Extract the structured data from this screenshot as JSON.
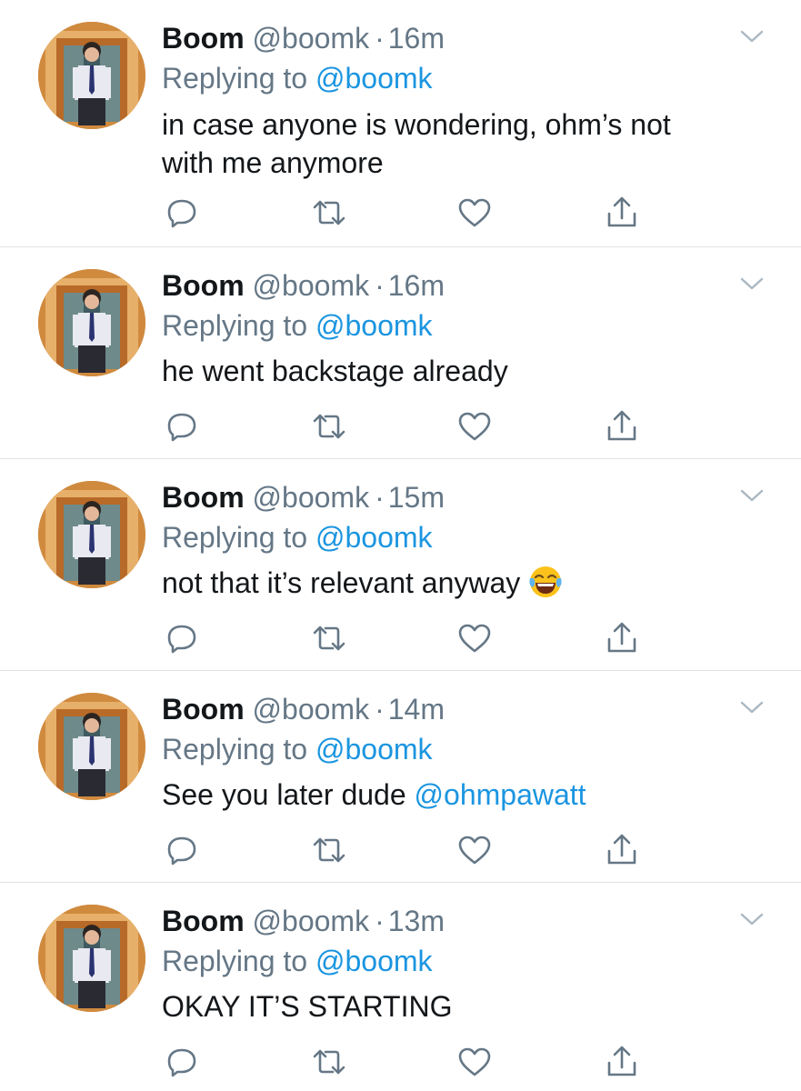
{
  "theme": {
    "text_color": "#14171a",
    "secondary_color": "#657786",
    "link_color": "#1b95e0",
    "divider_color": "#dfe3e7"
  },
  "icons": {
    "caret": "chevron-down-icon",
    "reply": "reply-icon",
    "retweet": "retweet-icon",
    "like": "heart-icon",
    "share": "share-icon",
    "emoji": "face-with-tears-of-joy-emoji"
  },
  "tweets": [
    {
      "name": "Boom",
      "handle": "@boomk",
      "dot": "·",
      "time": "16m",
      "replying_prefix": "Replying to",
      "replying_to": "@boomk",
      "text": "in case anyone is wondering, ohm’s not with me anymore"
    },
    {
      "name": "Boom",
      "handle": "@boomk",
      "dot": "·",
      "time": "16m",
      "replying_prefix": "Replying to",
      "replying_to": "@boomk",
      "text": "he went backstage already"
    },
    {
      "name": "Boom",
      "handle": "@boomk",
      "dot": "·",
      "time": "15m",
      "replying_prefix": "Replying to",
      "replying_to": "@boomk",
      "text": "not that it’s relevant anyway"
    },
    {
      "name": "Boom",
      "handle": "@boomk",
      "dot": "·",
      "time": "14m",
      "replying_prefix": "Replying to",
      "replying_to": "@boomk",
      "text": "See you later dude",
      "text_mention": "@ohmpawatt"
    },
    {
      "name": "Boom",
      "handle": "@boomk",
      "dot": "·",
      "time": "13m",
      "replying_prefix": "Replying to",
      "replying_to": "@boomk",
      "text": "OKAY IT’S STARTING"
    }
  ]
}
